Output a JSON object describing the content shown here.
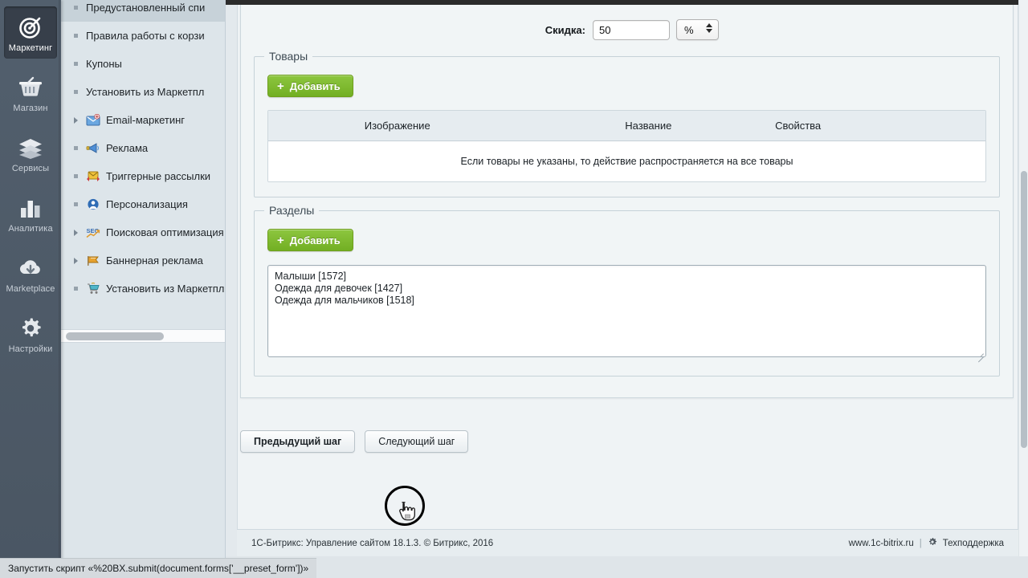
{
  "rail": {
    "items": [
      {
        "label": "Маркетинг",
        "icon": "target-icon",
        "active": true
      },
      {
        "label": "Магазин",
        "icon": "basket-icon",
        "active": false
      },
      {
        "label": "Сервисы",
        "icon": "layers-icon",
        "active": false
      },
      {
        "label": "Аналитика",
        "icon": "bar-chart-icon",
        "active": false
      },
      {
        "label": "Marketplace",
        "icon": "cloud-down-icon",
        "active": false
      },
      {
        "label": "Настройки",
        "icon": "gear-icon",
        "active": false
      }
    ]
  },
  "tree": {
    "items": [
      {
        "label": "Предустановленный спи",
        "marker": "bullet",
        "icon": null,
        "selected": true
      },
      {
        "label": "Правила работы с корзи",
        "marker": "bullet",
        "icon": null,
        "selected": false
      },
      {
        "label": "Купоны",
        "marker": "bullet",
        "icon": null,
        "selected": false
      },
      {
        "label": "Установить из Маркетпл",
        "marker": "bullet",
        "icon": null,
        "selected": false
      },
      {
        "label": "Email-маркетинг",
        "marker": "arrow",
        "icon": "envelope-plus-icon",
        "selected": false
      },
      {
        "label": "Реклама",
        "marker": "bullet",
        "icon": "megaphone-icon",
        "selected": false
      },
      {
        "label": "Триггерные рассылки",
        "marker": "bullet",
        "icon": "envelope-arrows-icon",
        "selected": false
      },
      {
        "label": "Персонализация",
        "marker": "bullet",
        "icon": "person-circle-icon",
        "selected": false
      },
      {
        "label": "Поисковая оптимизация",
        "marker": "arrow",
        "icon": "seo-icon",
        "selected": false
      },
      {
        "label": "Баннерная реклама",
        "marker": "arrow",
        "icon": "banner-flag-icon",
        "selected": false
      },
      {
        "label": "Установить из Маркетпл",
        "marker": "bullet",
        "icon": "cart-icon",
        "selected": false
      }
    ]
  },
  "form": {
    "discount": {
      "label": "Скидка:",
      "value": "50",
      "unit_selected": "%"
    },
    "products_block": {
      "legend": "Товары",
      "add_label": "Добавить",
      "columns": [
        "Изображение",
        "Название",
        "Свойства"
      ],
      "empty_message": "Если товары не указаны, то действие распространяется на все товары"
    },
    "sections_block": {
      "legend": "Разделы",
      "add_label": "Добавить",
      "textarea_value": "Малыши [1572]\nОдежда для девочек [1427]\nОдежда для мальчиков [1518]"
    },
    "steps": {
      "prev_label": "Предыдущий шаг",
      "next_label": "Следующий шаг"
    }
  },
  "footer": {
    "copyright": "1С-Битрикс: Управление сайтом 18.1.3. © Битрикс, 2016",
    "site_url": "www.1c-bitrix.ru",
    "separator": "|",
    "support_label": "Техподдержка"
  },
  "statusbar": {
    "text": "Запустить скрипт «%20BX.submit(document.forms['__preset_form'])»"
  },
  "colors": {
    "rail_bg": "#4e5a68",
    "rail_active": "#373f4a",
    "tree_bg": "#dde5ea",
    "tree_selected": "#c7d2d9",
    "accent_green": "#8dc63f",
    "page_bg": "#eff3f5"
  }
}
